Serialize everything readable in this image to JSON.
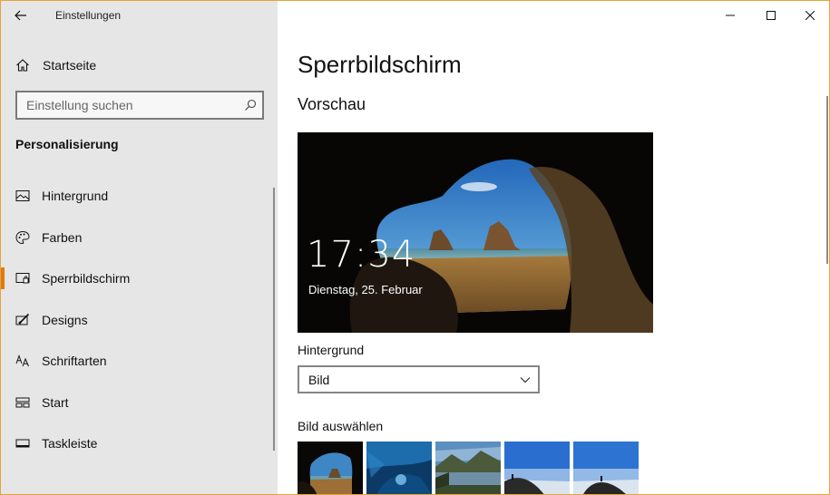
{
  "window": {
    "title": "Einstellungen"
  },
  "sidebar": {
    "home_label": "Startseite",
    "search_placeholder": "Einstellung suchen",
    "section_title": "Personalisierung",
    "items": [
      {
        "label": "Hintergrund",
        "icon": "picture-icon"
      },
      {
        "label": "Farben",
        "icon": "palette-icon"
      },
      {
        "label": "Sperrbildschirm",
        "icon": "lock-screen-icon",
        "active": true
      },
      {
        "label": "Designs",
        "icon": "brush-icon"
      },
      {
        "label": "Schriftarten",
        "icon": "font-icon"
      },
      {
        "label": "Start",
        "icon": "start-icon"
      },
      {
        "label": "Taskleiste",
        "icon": "taskbar-icon"
      }
    ]
  },
  "main": {
    "title": "Sperrbildschirm",
    "preview_heading": "Vorschau",
    "preview": {
      "time": "17:34",
      "date": "Dienstag, 25. Februar"
    },
    "background_label": "Hintergrund",
    "background_value": "Bild",
    "choose_picture_label": "Bild auswählen"
  },
  "colors": {
    "accent": "#e07a10",
    "sidebar_bg": "#e6e6e6",
    "window_border": "#e8a33d"
  }
}
